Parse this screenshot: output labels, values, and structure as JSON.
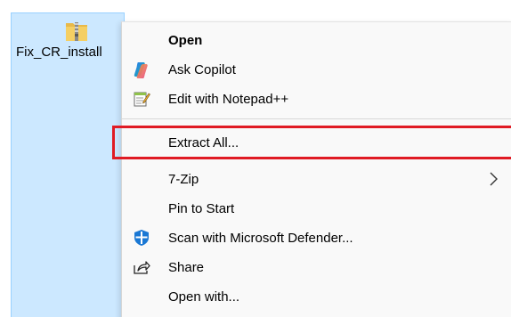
{
  "file": {
    "name": "Fix_CR_install",
    "icon": "zip-folder-icon"
  },
  "context_menu": {
    "items": [
      {
        "label": "Open",
        "icon": "",
        "bold": true
      },
      {
        "label": "Ask Copilot",
        "icon": "copilot-icon"
      },
      {
        "label": "Edit with Notepad++",
        "icon": "notepad-plus-plus-icon"
      },
      {
        "label": "Extract All...",
        "icon": ""
      },
      {
        "label": "7-Zip",
        "icon": "",
        "submenu": true
      },
      {
        "label": "Pin to Start",
        "icon": ""
      },
      {
        "label": "Scan with Microsoft Defender...",
        "icon": "defender-shield-icon"
      },
      {
        "label": "Share",
        "icon": "share-icon"
      },
      {
        "label": "Open with...",
        "icon": ""
      }
    ]
  },
  "colors": {
    "selection_bg": "#cce8ff",
    "highlight_border": "#e01b24",
    "menu_bg": "#f9f9f9"
  }
}
